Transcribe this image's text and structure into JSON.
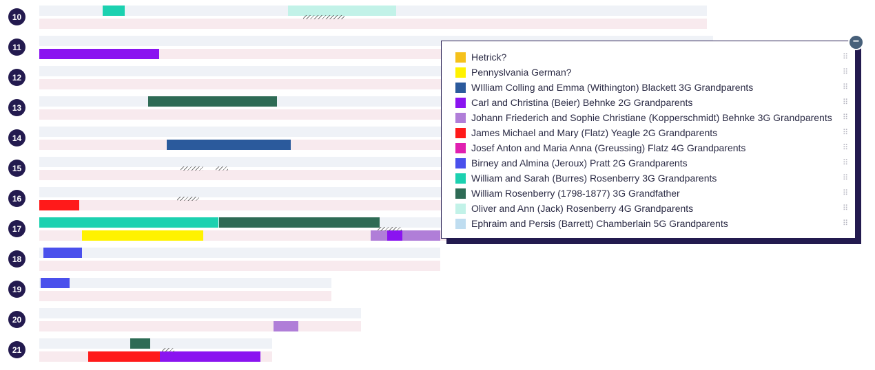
{
  "chromosomes": [
    {
      "num": "10"
    },
    {
      "num": "11"
    },
    {
      "num": "12"
    },
    {
      "num": "13"
    },
    {
      "num": "14"
    },
    {
      "num": "15"
    },
    {
      "num": "16"
    },
    {
      "num": "17"
    },
    {
      "num": "18"
    },
    {
      "num": "19"
    },
    {
      "num": "20"
    },
    {
      "num": "21"
    }
  ],
  "legend": {
    "collapse_label": "−",
    "handle_glyph": "⠿",
    "items": [
      {
        "label": "Hetrick?",
        "color": "#f5c11b"
      },
      {
        "label": "Pennyslvania German?",
        "color": "#fff200"
      },
      {
        "label": "WIlliam Colling and Emma (Withington) Blackett 3G Grandparents",
        "color": "#2b5a9c"
      },
      {
        "label": "Carl and Christina (Beier) Behnke 2G Grandparents",
        "color": "#8a14f0"
      },
      {
        "label": "Johann Friederich and Sophie Christiane (Kopperschmidt) Behnke 3G Grandparents",
        "color": "#b07ed8"
      },
      {
        "label": "James Michael and Mary (Flatz) Yeagle 2G Grandparents",
        "color": "#ff1a1a"
      },
      {
        "label": "Josef Anton and Maria Anna (Greussing) Flatz 4G Grandparents",
        "color": "#e020b0"
      },
      {
        "label": "Birney and Almina (Jeroux) Pratt 2G Grandparents",
        "color": "#4a50ec"
      },
      {
        "label": "William and Sarah (Burres) Rosenberry 3G Grandparents",
        "color": "#1cd1b0"
      },
      {
        "label": "William Rosenberry (1798-1877) 3G Grandfather",
        "color": "#2e6b55"
      },
      {
        "label": "Oliver and Ann (Jack) Rosenberry 4G Grandparents",
        "color": "#c2f2e8"
      },
      {
        "label": "Ephraim and Persis (Barrett) Chamberlain 5G Grandparents",
        "color": "#bfddf0"
      }
    ]
  }
}
